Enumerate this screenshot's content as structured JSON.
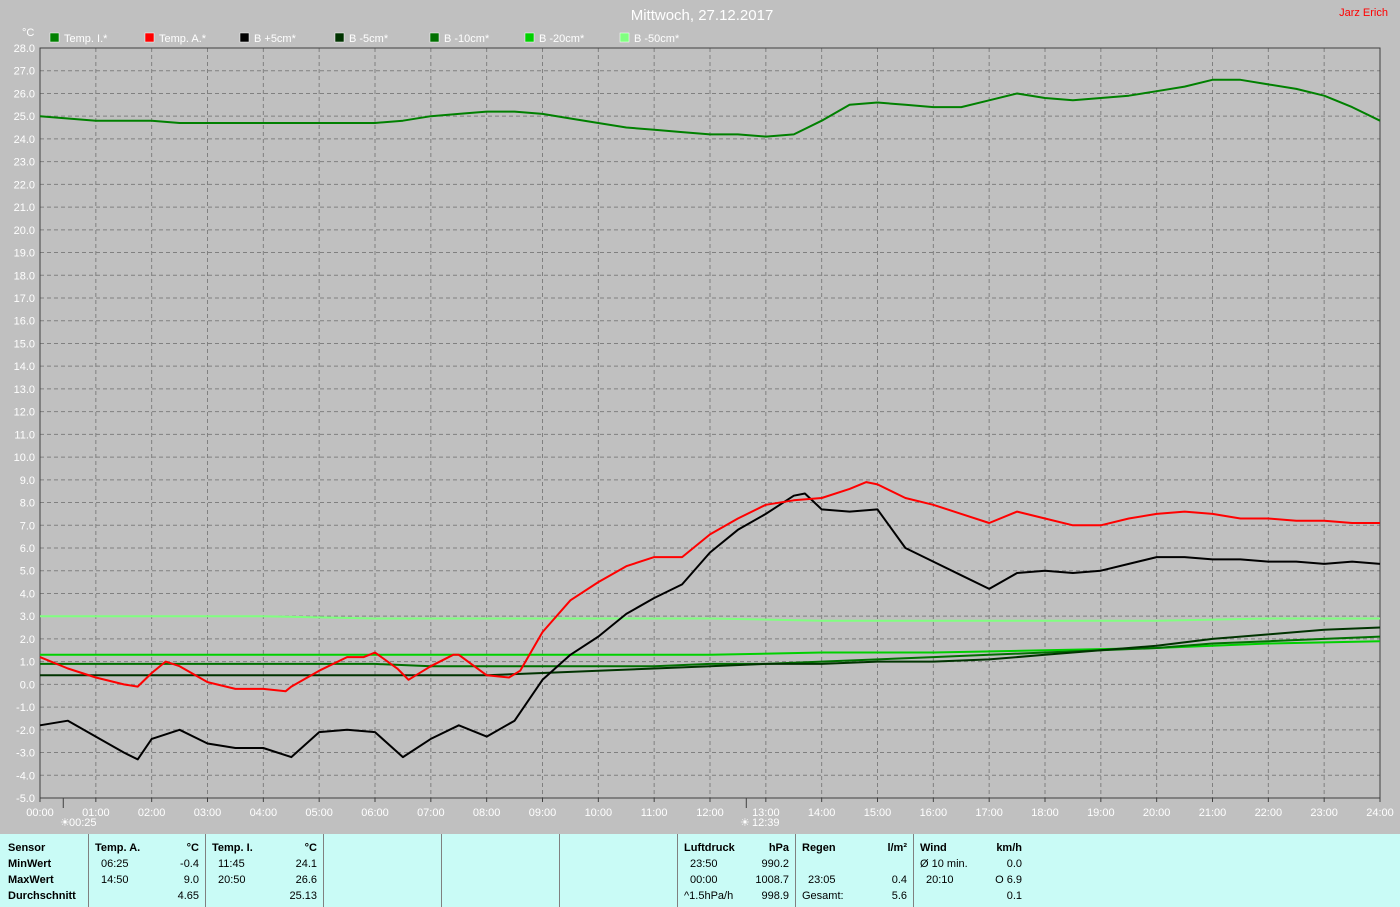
{
  "header": {
    "title": "Mittwoch, 27.12.2017",
    "author": "Jarz Erich"
  },
  "markers": {
    "sunrise": "00:25",
    "sunset": "12:39"
  },
  "chart_data": {
    "type": "line",
    "ylabel": "°C",
    "ylim": [
      -5,
      28
    ],
    "xlim": [
      0,
      24
    ],
    "grid": true,
    "legend_position": "top-left",
    "yticks": [
      "28.0",
      "27.0",
      "26.0",
      "25.0",
      "24.0",
      "23.0",
      "22.0",
      "21.0",
      "20.0",
      "19.0",
      "18.0",
      "17.0",
      "16.0",
      "15.0",
      "14.0",
      "13.0",
      "12.0",
      "11.0",
      "10.0",
      "9.0",
      "8.0",
      "7.0",
      "6.0",
      "5.0",
      "4.0",
      "3.0",
      "2.0",
      "1.0",
      "0.0",
      "-1.0",
      "-2.0",
      "-3.0",
      "-4.0",
      "-5.0"
    ],
    "xticks": [
      "00:00",
      "01:00",
      "02:00",
      "03:00",
      "04:00",
      "05:00",
      "06:00",
      "07:00",
      "08:00",
      "09:00",
      "10:00",
      "11:00",
      "12:00",
      "13:00",
      "14:00",
      "15:00",
      "16:00",
      "17:00",
      "18:00",
      "19:00",
      "20:00",
      "21:00",
      "22:00",
      "23:00",
      "24:00"
    ],
    "series": [
      {
        "name": "Temp. I.*",
        "color": "#008000",
        "x": [
          0,
          0.5,
          1,
          1.5,
          2,
          2.5,
          3,
          3.5,
          4,
          4.5,
          5,
          5.5,
          6,
          6.5,
          7,
          7.5,
          8,
          8.5,
          9,
          9.5,
          10,
          10.5,
          11,
          11.5,
          12,
          12.5,
          13,
          13.5,
          14,
          14.5,
          15,
          15.5,
          16,
          16.5,
          17,
          17.5,
          18,
          18.5,
          19,
          19.5,
          20,
          20.5,
          21,
          21.5,
          22,
          22.5,
          23,
          23.5,
          24
        ],
        "values": [
          25.0,
          24.9,
          24.8,
          24.8,
          24.8,
          24.7,
          24.7,
          24.7,
          24.7,
          24.7,
          24.7,
          24.7,
          24.7,
          24.8,
          25.0,
          25.1,
          25.2,
          25.2,
          25.1,
          24.9,
          24.7,
          24.5,
          24.4,
          24.3,
          24.2,
          24.2,
          24.1,
          24.2,
          24.8,
          25.5,
          25.6,
          25.5,
          25.4,
          25.4,
          25.7,
          26.0,
          25.8,
          25.7,
          25.8,
          25.9,
          26.1,
          26.3,
          26.6,
          26.6,
          26.4,
          26.2,
          25.9,
          25.4,
          24.8
        ]
      },
      {
        "name": "Temp. A.*",
        "color": "#ff0000",
        "x": [
          0,
          0.5,
          1,
          1.5,
          1.75,
          2,
          2.25,
          2.5,
          3,
          3.5,
          4,
          4.4,
          4.5,
          5,
          5.5,
          5.8,
          6,
          6.4,
          6.6,
          7,
          7.4,
          7.5,
          8,
          8.4,
          8.6,
          9,
          9.5,
          10,
          10.5,
          11,
          11.5,
          12,
          12.5,
          13,
          13.5,
          14,
          14.5,
          14.8,
          15,
          15.5,
          16,
          16.5,
          17,
          17.5,
          18,
          18.5,
          19,
          19.5,
          20,
          20.5,
          21,
          21.5,
          22,
          22.5,
          23,
          23.5,
          24
        ],
        "values": [
          1.2,
          0.7,
          0.3,
          0.0,
          -0.1,
          0.5,
          1.0,
          0.8,
          0.1,
          -0.2,
          -0.2,
          -0.3,
          -0.1,
          0.6,
          1.2,
          1.2,
          1.4,
          0.7,
          0.2,
          0.8,
          1.3,
          1.3,
          0.4,
          0.3,
          0.6,
          2.3,
          3.7,
          4.5,
          5.2,
          5.6,
          5.6,
          6.6,
          7.3,
          7.9,
          8.1,
          8.2,
          8.6,
          8.9,
          8.8,
          8.2,
          7.9,
          7.5,
          7.1,
          7.6,
          7.3,
          7.0,
          7.0,
          7.3,
          7.5,
          7.6,
          7.5,
          7.3,
          7.3,
          7.2,
          7.2,
          7.1,
          7.1
        ]
      },
      {
        "name": "B +5cm*",
        "color": "#000000",
        "x": [
          0,
          0.5,
          1,
          1.5,
          1.75,
          2,
          2.5,
          3,
          3.5,
          4,
          4.5,
          5,
          5.5,
          6,
          6.5,
          7,
          7.5,
          8,
          8.5,
          9,
          9.5,
          10,
          10.5,
          11,
          11.5,
          12,
          12.5,
          13,
          13.5,
          13.7,
          14,
          14.5,
          15,
          15.5,
          16,
          16.5,
          17,
          17.5,
          18,
          18.5,
          19,
          19.5,
          20,
          20.5,
          21,
          21.5,
          22,
          22.5,
          23,
          23.5,
          24
        ],
        "values": [
          -1.8,
          -1.6,
          -2.3,
          -3.0,
          -3.3,
          -2.4,
          -2.0,
          -2.6,
          -2.8,
          -2.8,
          -3.2,
          -2.1,
          -2.0,
          -2.1,
          -3.2,
          -2.4,
          -1.8,
          -2.3,
          -1.6,
          0.2,
          1.3,
          2.1,
          3.1,
          3.8,
          4.4,
          5.8,
          6.8,
          7.5,
          8.3,
          8.4,
          7.7,
          7.6,
          7.7,
          6.0,
          5.4,
          4.8,
          4.2,
          4.9,
          5.0,
          4.9,
          5.0,
          5.3,
          5.6,
          5.6,
          5.5,
          5.5,
          5.4,
          5.4,
          5.3,
          5.4,
          5.3
        ]
      },
      {
        "name": "B -5cm*",
        "color": "#003300",
        "x": [
          0,
          2,
          4,
          6,
          7,
          8,
          9,
          10,
          11,
          12,
          13,
          14,
          15,
          16,
          17,
          18,
          19,
          20,
          21,
          22,
          23,
          24
        ],
        "values": [
          0.4,
          0.4,
          0.4,
          0.4,
          0.4,
          0.4,
          0.5,
          0.6,
          0.7,
          0.8,
          0.9,
          0.9,
          1.0,
          1.0,
          1.1,
          1.3,
          1.5,
          1.7,
          2.0,
          2.2,
          2.4,
          2.5
        ]
      },
      {
        "name": "B -10cm*",
        "color": "#007000",
        "x": [
          0,
          2,
          4,
          6,
          7,
          8,
          9,
          10,
          11,
          12,
          13,
          14,
          15,
          16,
          17,
          18,
          19,
          20,
          21,
          22,
          23,
          24
        ],
        "values": [
          0.9,
          0.9,
          0.9,
          0.9,
          0.8,
          0.8,
          0.8,
          0.8,
          0.8,
          0.9,
          0.9,
          1.0,
          1.1,
          1.2,
          1.3,
          1.4,
          1.5,
          1.6,
          1.8,
          1.9,
          2.0,
          2.1
        ]
      },
      {
        "name": "B -20cm*",
        "color": "#00d000",
        "x": [
          0,
          2,
          4,
          6,
          8,
          10,
          12,
          14,
          16,
          18,
          20,
          22,
          24
        ],
        "values": [
          1.3,
          1.3,
          1.3,
          1.3,
          1.3,
          1.3,
          1.3,
          1.4,
          1.4,
          1.5,
          1.6,
          1.8,
          1.9
        ]
      },
      {
        "name": "B -50cm*",
        "color": "#80ff80",
        "x": [
          0,
          2,
          4,
          6,
          8,
          10,
          12,
          14,
          16,
          18,
          20,
          22,
          24
        ],
        "values": [
          3.0,
          3.0,
          3.0,
          2.9,
          2.9,
          2.9,
          2.9,
          2.8,
          2.8,
          2.8,
          2.8,
          2.9,
          2.9
        ]
      }
    ]
  },
  "stats": {
    "col1": {
      "h": "Sensor",
      "r1": "MinWert",
      "r2": "MaxWert",
      "r3": "Durchschnitt"
    },
    "col2": {
      "h": "Temp. A.",
      "u": "°C",
      "t1": "06:25",
      "v1": "-0.4",
      "t2": "14:50",
      "v2": "9.0",
      "v3": "4.65"
    },
    "col3": {
      "h": "Temp. I.",
      "u": "°C",
      "t1": "11:45",
      "v1": "24.1",
      "t2": "20:50",
      "v2": "26.6",
      "v3": "25.13"
    },
    "col4": {
      "h": "Luftdruck",
      "u": "hPa",
      "t1": "23:50",
      "v1": "990.2",
      "t2": "00:00",
      "v2": "1008.7",
      "t3": "^1.5hPa/h",
      "v3": "998.9"
    },
    "col5": {
      "h": "Regen",
      "u": "l/m²",
      "t2": "23:05",
      "v2": "0.4",
      "t3": "Gesamt:",
      "v3": "5.6"
    },
    "col6": {
      "h": "Wind",
      "u": "km/h",
      "t1": "Ø 10 min.",
      "v1": "0.0",
      "t2": "20:10",
      "v2": "O 6.9",
      "v3": "0.1"
    }
  }
}
